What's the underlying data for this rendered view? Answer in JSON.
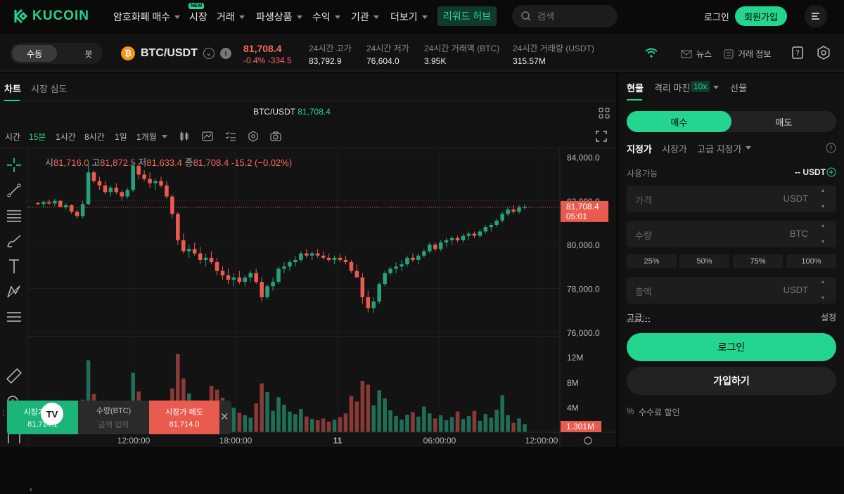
{
  "nav": {
    "brand": "KUCOIN",
    "items": [
      "암호화폐 매수",
      "시장",
      "거래",
      "파생상품",
      "수익",
      "기관",
      "더보기"
    ],
    "new_badge": "NEW",
    "reward_hub": "리워드 허브",
    "search_placeholder": "검색",
    "login": "로그인",
    "signup": "회원가입"
  },
  "ticker": {
    "mode_manual": "수동",
    "mode_bot": "봇",
    "coin_glyph": "₿",
    "pair": "BTC/USDT",
    "price": "81,708.4",
    "change_pct": "-0.4%",
    "change_abs": "-334.5",
    "high_label": "24시간 고가",
    "high": "83,792.9",
    "low_label": "24시간 저가",
    "low": "76,604.0",
    "vol_btc_label": "24시간 거래액 (BTC)",
    "vol_btc": "3.95K",
    "vol_usdt_label": "24시간 거래량 (USDT)",
    "vol_usdt": "315.57M",
    "news": "뉴스",
    "trade_info": "거래 정보"
  },
  "chart_tabs": {
    "chart": "차트",
    "depth": "시장 심도"
  },
  "chart_header": {
    "pair": "BTC/USDT",
    "price": "81,708.4"
  },
  "intervals": {
    "time": "시간",
    "m15": "15분",
    "h1": "1시간",
    "h8": "8시간",
    "d1": "1일",
    "mo1": "1개월"
  },
  "ohlc": {
    "o_label": "시",
    "o": "81,716.0",
    "h_label": "고",
    "h": "81,872.5",
    "l_label": "저",
    "l": "81,633.4",
    "c_label": "종",
    "c": "81,708.4",
    "chg": "-15.2 (−0.02%)"
  },
  "price_axis": [
    "84,000.0",
    "82,000.0",
    "80,000.0",
    "78,000.0",
    "76,000.0"
  ],
  "last_price": {
    "price": "81,708.4",
    "countdown": "05:01"
  },
  "volume_axis": [
    "12M",
    "8M",
    "4M"
  ],
  "last_volume": "1.301M",
  "time_axis": [
    "12:00:00",
    "18:00:00",
    "11",
    "06:00:00",
    "12:00:00"
  ],
  "quick_trade": {
    "buy_label": "시장가 매수",
    "buy_price": "81,714.1",
    "qty_label": "수량(BTC)",
    "qty_placeholder": "금액 입력",
    "sell_label": "시장가 매도",
    "sell_price": "81,714.0"
  },
  "order": {
    "tab_spot": "현물",
    "tab_margin": "격리 마진",
    "margin_leverage": "10x",
    "tab_futures": "선물",
    "buy": "매수",
    "sell": "매도",
    "type_limit": "지정가",
    "type_market": "시장가",
    "type_adv": "고급 지정가",
    "available_label": "사용가능",
    "available_value": "-- USDT",
    "price_placeholder": "가격",
    "price_unit": "USDT",
    "qty_placeholder": "수량",
    "qty_unit": "BTC",
    "pcts": [
      "25%",
      "50%",
      "75%",
      "100%"
    ],
    "total_placeholder": "총액",
    "total_unit": "USDT",
    "advanced": "고급:--",
    "settings": "설정",
    "login": "로그인",
    "join": "가입하기",
    "fee_discount": "수수료 할인"
  },
  "chart_data": {
    "type": "candlestick",
    "ylim": [
      75800,
      84400
    ],
    "volume_ylim": [
      0,
      14500000
    ],
    "candles": [
      [
        81900,
        81950,
        81800,
        81850
      ],
      [
        81850,
        82000,
        81700,
        81950
      ],
      [
        81950,
        82050,
        81800,
        81880
      ],
      [
        81880,
        82100,
        81750,
        82000
      ],
      [
        82000,
        82050,
        81700,
        81720
      ],
      [
        81720,
        81900,
        81600,
        81800
      ],
      [
        81800,
        81850,
        81400,
        81500
      ],
      [
        81500,
        81600,
        81200,
        81300
      ],
      [
        81300,
        82000,
        81200,
        81850
      ],
      [
        81850,
        83800,
        81800,
        83300
      ],
      [
        83300,
        83400,
        82800,
        82900
      ],
      [
        82900,
        83100,
        82500,
        82700
      ],
      [
        82700,
        82900,
        82300,
        82400
      ],
      [
        82400,
        82700,
        82200,
        82600
      ],
      [
        82600,
        82800,
        82300,
        82400
      ],
      [
        82400,
        82500,
        82000,
        82200
      ],
      [
        82200,
        82600,
        82100,
        82500
      ],
      [
        82500,
        83800,
        82400,
        83600
      ],
      [
        83600,
        83700,
        83000,
        83200
      ],
      [
        83200,
        83400,
        82900,
        83000
      ],
      [
        83000,
        83300,
        82600,
        82800
      ],
      [
        82800,
        83000,
        82500,
        82900
      ],
      [
        82900,
        83100,
        82600,
        82700
      ],
      [
        82700,
        82900,
        82100,
        82200
      ],
      [
        82200,
        82300,
        81200,
        81400
      ],
      [
        81400,
        81500,
        80000,
        80200
      ],
      [
        80200,
        80500,
        79600,
        79700
      ],
      [
        79700,
        80000,
        79400,
        79800
      ],
      [
        79800,
        80100,
        79500,
        79600
      ],
      [
        79600,
        79900,
        79100,
        79300
      ],
      [
        79300,
        79600,
        79000,
        79400
      ],
      [
        79400,
        79700,
        79100,
        79200
      ],
      [
        79200,
        79400,
        78600,
        78800
      ],
      [
        78800,
        79000,
        78400,
        78600
      ],
      [
        78600,
        78900,
        78200,
        78400
      ],
      [
        78400,
        78700,
        78100,
        78500
      ],
      [
        78500,
        78800,
        78200,
        78300
      ],
      [
        78300,
        78600,
        78100,
        78500
      ],
      [
        78500,
        78800,
        78300,
        78700
      ],
      [
        78700,
        78900,
        78200,
        78300
      ],
      [
        78300,
        78500,
        77400,
        77600
      ],
      [
        77600,
        78200,
        77500,
        78100
      ],
      [
        78100,
        78500,
        77900,
        78300
      ],
      [
        78300,
        79000,
        78200,
        78900
      ],
      [
        78900,
        79200,
        78700,
        79000
      ],
      [
        79000,
        79300,
        78800,
        79200
      ],
      [
        79200,
        79500,
        79000,
        79300
      ],
      [
        79300,
        79700,
        79200,
        79600
      ],
      [
        79600,
        79800,
        79400,
        79500
      ],
      [
        79500,
        79700,
        79300,
        79600
      ],
      [
        79600,
        79800,
        79400,
        79500
      ],
      [
        79500,
        79700,
        79300,
        79400
      ],
      [
        79400,
        79600,
        79200,
        79300
      ],
      [
        79300,
        79500,
        79100,
        79400
      ],
      [
        79400,
        79600,
        79200,
        79300
      ],
      [
        79300,
        79500,
        79100,
        79200
      ],
      [
        79200,
        79300,
        78700,
        78800
      ],
      [
        78800,
        79100,
        78600,
        78500
      ],
      [
        78500,
        78700,
        77300,
        77600
      ],
      [
        77600,
        77900,
        76900,
        77100
      ],
      [
        77100,
        77600,
        76900,
        77400
      ],
      [
        77400,
        78300,
        77300,
        78200
      ],
      [
        78200,
        78800,
        78100,
        78700
      ],
      [
        78700,
        79000,
        78600,
        78900
      ],
      [
        78900,
        79200,
        78700,
        79000
      ],
      [
        79000,
        79300,
        78800,
        79100
      ],
      [
        79100,
        79500,
        79000,
        79400
      ],
      [
        79400,
        79600,
        79200,
        79300
      ],
      [
        79300,
        79600,
        79100,
        79500
      ],
      [
        79500,
        79800,
        79400,
        79700
      ],
      [
        79700,
        80100,
        79600,
        80000
      ],
      [
        80000,
        80100,
        79700,
        79800
      ],
      [
        79800,
        80200,
        79700,
        80100
      ],
      [
        80100,
        80300,
        79900,
        80200
      ],
      [
        80200,
        80400,
        80000,
        80300
      ],
      [
        80300,
        80400,
        80100,
        80200
      ],
      [
        80200,
        80500,
        80100,
        80400
      ],
      [
        80400,
        80600,
        80200,
        80500
      ],
      [
        80500,
        80600,
        80300,
        80400
      ],
      [
        80400,
        80700,
        80300,
        80600
      ],
      [
        80600,
        80900,
        80500,
        80800
      ],
      [
        80800,
        81000,
        80600,
        80900
      ],
      [
        80900,
        81200,
        80800,
        81100
      ],
      [
        81100,
        81500,
        81000,
        81400
      ],
      [
        81400,
        81700,
        81300,
        81600
      ],
      [
        81600,
        81800,
        81400,
        81500
      ],
      [
        81500,
        81800,
        81400,
        81700
      ],
      [
        81700,
        81850,
        81600,
        81708
      ]
    ],
    "volumes": [
      2.1,
      1.8,
      2.5,
      1.6,
      3.2,
      2.0,
      4.5,
      3.1,
      5.2,
      11.5,
      6.1,
      4.2,
      3.5,
      2.8,
      2.2,
      1.9,
      4.8,
      9.5,
      6.5,
      4.1,
      3.0,
      2.6,
      2.4,
      3.8,
      7.0,
      12.5,
      8.6,
      6.2,
      5.1,
      4.0,
      3.6,
      7.4,
      6.8,
      5.5,
      4.7,
      3.9,
      3.1,
      2.7,
      2.3,
      4.6,
      7.8,
      6.4,
      3.4,
      5.6,
      4.4,
      3.3,
      2.9,
      3.7,
      2.5,
      2.1,
      1.9,
      2.2,
      1.7,
      2.0,
      2.4,
      3.0,
      5.8,
      4.9,
      8.2,
      7.6,
      4.3,
      6.7,
      5.4,
      3.5,
      2.6,
      2.0,
      2.8,
      3.2,
      2.5,
      4.1,
      3.0,
      2.2,
      2.7,
      1.9,
      2.4,
      3.3,
      2.1,
      2.6,
      3.4,
      1.8,
      2.9,
      2.3,
      3.6,
      5.9,
      2.7,
      1.5,
      2.2,
      1.3
    ]
  }
}
